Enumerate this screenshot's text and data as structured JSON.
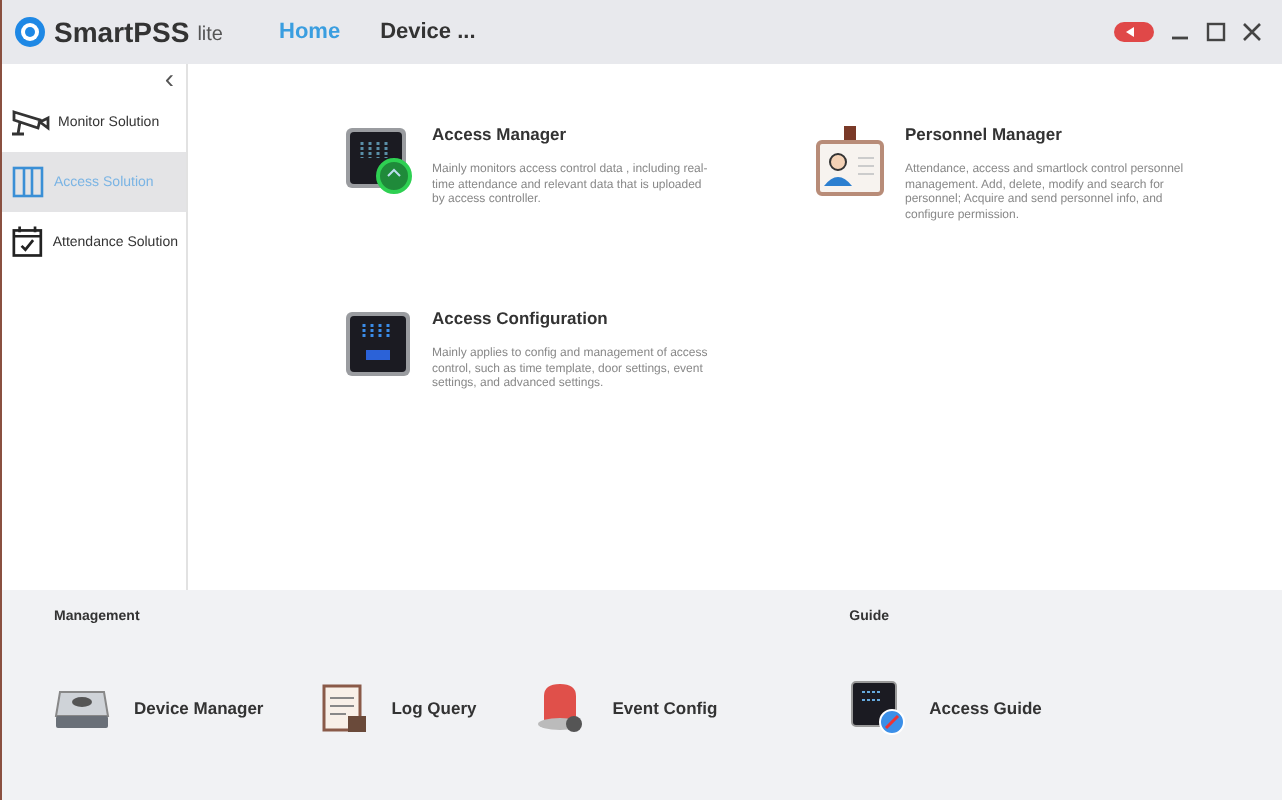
{
  "app": {
    "name": "SmartPSS",
    "edition": "lite"
  },
  "tabs": [
    {
      "label": "Home",
      "selected": true
    },
    {
      "label": "Device ...",
      "selected": false
    }
  ],
  "sidebar": {
    "collapse": "‹",
    "items": [
      {
        "label": "Monitor Solution",
        "kind": "camera",
        "selected": false
      },
      {
        "label": "Access Solution",
        "kind": "door",
        "selected": true
      },
      {
        "label": "Attendance Solution",
        "kind": "calendar",
        "selected": false
      }
    ]
  },
  "modules": [
    {
      "title": "Access Manager",
      "kind": "manager",
      "description": "Mainly monitors access control data , including real-time attendance and relevant data that is uploaded by access controller."
    },
    {
      "title": "Personnel Manager",
      "kind": "badge",
      "description": "Attendance,  access and smartlock control personnel management.  Add, delete, modify and search for personnel; Acquire and send personnel info, and configure permission."
    },
    {
      "title": "Access Configuration",
      "kind": "config",
      "description": "Mainly applies to config and management of access control, such as time template, door settings, event settings, and advanced settings."
    }
  ],
  "management": {
    "heading": "Management",
    "items": [
      {
        "label": "Device Manager",
        "kind": "drive"
      },
      {
        "label": "Log Query",
        "kind": "log"
      },
      {
        "label": "Event Config",
        "kind": "alarm"
      }
    ]
  },
  "guide": {
    "heading": "Guide",
    "items": [
      {
        "label": "Access Guide",
        "kind": "guide"
      }
    ]
  }
}
